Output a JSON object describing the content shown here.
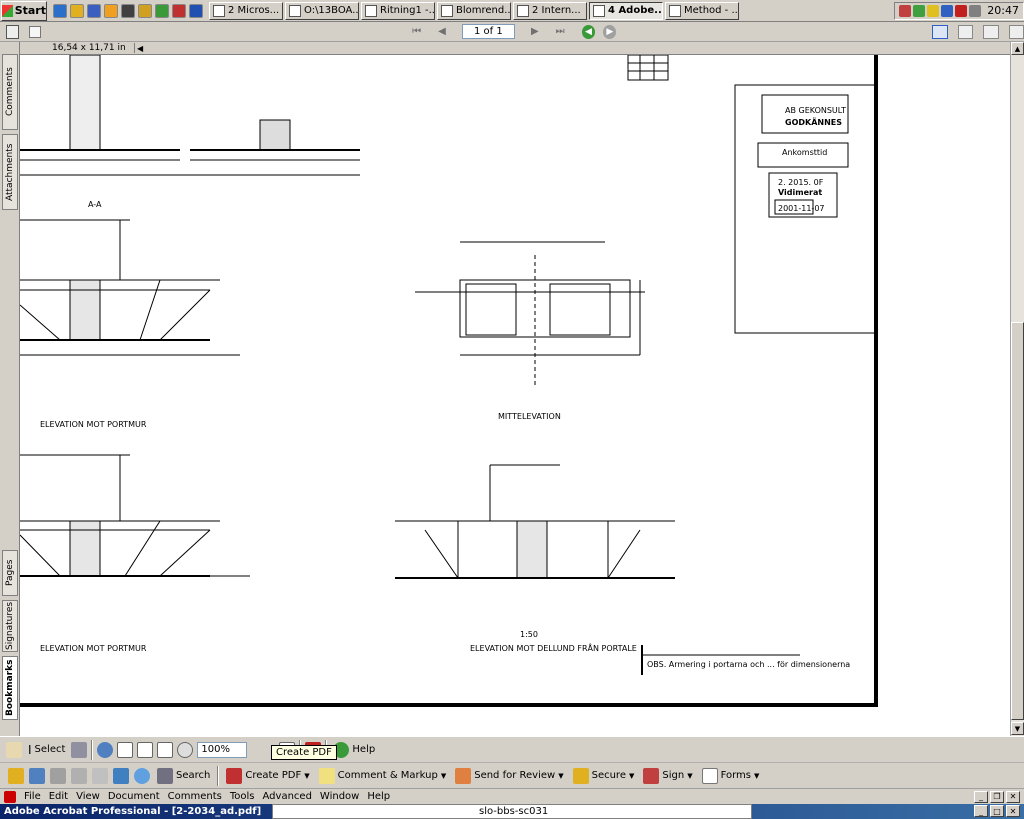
{
  "taskbar": {
    "start_label": "Start",
    "tasks": [
      {
        "label": "2 Micros...",
        "active": false
      },
      {
        "label": "O:\\13BOA...",
        "active": false
      },
      {
        "label": "Ritning1 -...",
        "active": false
      },
      {
        "label": "Blomrend...",
        "active": false
      },
      {
        "label": "2 Intern...",
        "active": false
      },
      {
        "label": "4 Adobe...",
        "active": true
      },
      {
        "label": "Method - ...",
        "active": false
      }
    ],
    "clock": "20:47"
  },
  "navigation": {
    "page_indicator": "1 of 1"
  },
  "document": {
    "page_size": "16,54 x 11,71 in",
    "stamp_title": "GODKÄNNES",
    "stamp_company": "AB GEKONSULT",
    "stamp_received": "Ankomsttid",
    "stamp_date": "2001-11-07",
    "stamp_approved": "Vidimerat",
    "stamp_ref": "2. 2015. 0F",
    "view_label_1": "MITTELEVATION",
    "view_label_2": "ELEVATION MOT PORTMUR",
    "view_label_3": "ELEVATION MOT DELLUND FRÅN PORTALE",
    "view_label_4": "ELEVATION MOT PORTMUR",
    "scale_label": "1:50",
    "section_label": "A-A",
    "footnote": "OBS. Armering i portarna och ... för dimensionerna"
  },
  "left_tabs": [
    "Bookmarks",
    "Signatures",
    "Pages",
    "Attachments",
    "Comments"
  ],
  "toolbar1": {
    "select_label": "Select",
    "zoom_value": "100%",
    "help_label": "Help",
    "tooltip": "Create PDF"
  },
  "toolbar2": {
    "search_label": "Search",
    "create_pdf_label": "Create PDF",
    "comment_label": "Comment & Markup",
    "review_label": "Send for Review",
    "secure_label": "Secure",
    "sign_label": "Sign",
    "forms_label": "Forms"
  },
  "menubar": {
    "items": [
      "File",
      "Edit",
      "View",
      "Document",
      "Comments",
      "Tools",
      "Advanced",
      "Window",
      "Help"
    ]
  },
  "titlebar": {
    "title": "Adobe Acrobat Professional - [2-2034_ad.pdf]",
    "doc_tab": "slo-bbs-sc031"
  },
  "colors": {
    "title_start": "#0a246a",
    "title_end": "#3a6ea5",
    "chrome": "#d4d0c8"
  }
}
